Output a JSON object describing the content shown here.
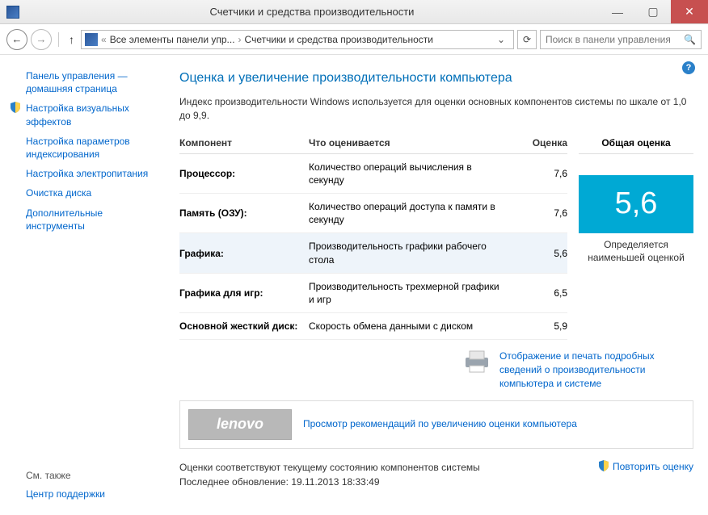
{
  "window": {
    "title": "Счетчики и средства производительности",
    "min": "—",
    "max": "▢",
    "close": "✕"
  },
  "nav": {
    "back": "←",
    "forward": "→",
    "up": "↑",
    "addr_prefix": "«",
    "addr_seg1": "Все элементы панели упр...",
    "addr_sep": "›",
    "addr_seg2": "Счетчики и средства производительности",
    "dropdown": "⌄",
    "refresh": "⟳",
    "search_placeholder": "Поиск в панели управления",
    "search_icon": "🔍"
  },
  "sidebar": {
    "items": [
      "Панель управления — домашняя страница",
      "Настройка визуальных эффектов",
      "Настройка параметров индексирования",
      "Настройка электропитания",
      "Очистка диска",
      "Дополнительные инструменты"
    ],
    "seealso_hdr": "См. также",
    "seealso": "Центр поддержки"
  },
  "help": "?",
  "heading": "Оценка и увеличение производительности компьютера",
  "intro": "Индекс производительности Windows используется для оценки основных компонентов системы по шкале от 1,0 до 9,9.",
  "table": {
    "h_component": "Компонент",
    "h_desc": "Что оценивается",
    "h_score": "Оценка",
    "h_overall": "Общая оценка",
    "rows": [
      {
        "comp": "Процессор:",
        "desc": "Количество операций вычисления в секунду",
        "score": "7,6"
      },
      {
        "comp": "Память (ОЗУ):",
        "desc": "Количество операций доступа к памяти в секунду",
        "score": "7,6"
      },
      {
        "comp": "Графика:",
        "desc": "Производительность графики рабочего стола",
        "score": "5,6"
      },
      {
        "comp": "Графика для игр:",
        "desc": "Производительность трехмерной графики и игр",
        "score": "6,5"
      },
      {
        "comp": "Основной жесткий диск:",
        "desc": "Скорость обмена данными с диском",
        "score": "5,9"
      }
    ],
    "overall_score": "5,6",
    "overall_caption": "Определяется наименьшей оценкой"
  },
  "print_link": "Отображение и печать подробных сведений о производительности компьютера и системе",
  "lenovo": {
    "logo": "lenovo",
    "link": "Просмотр рекомендаций по увеличению оценки компьютера"
  },
  "footer": {
    "line1": "Оценки соответствуют текущему состоянию компонентов системы",
    "line2": "Последнее обновление: 19.11.2013 18:33:49",
    "rerun": "Повторить оценку"
  }
}
